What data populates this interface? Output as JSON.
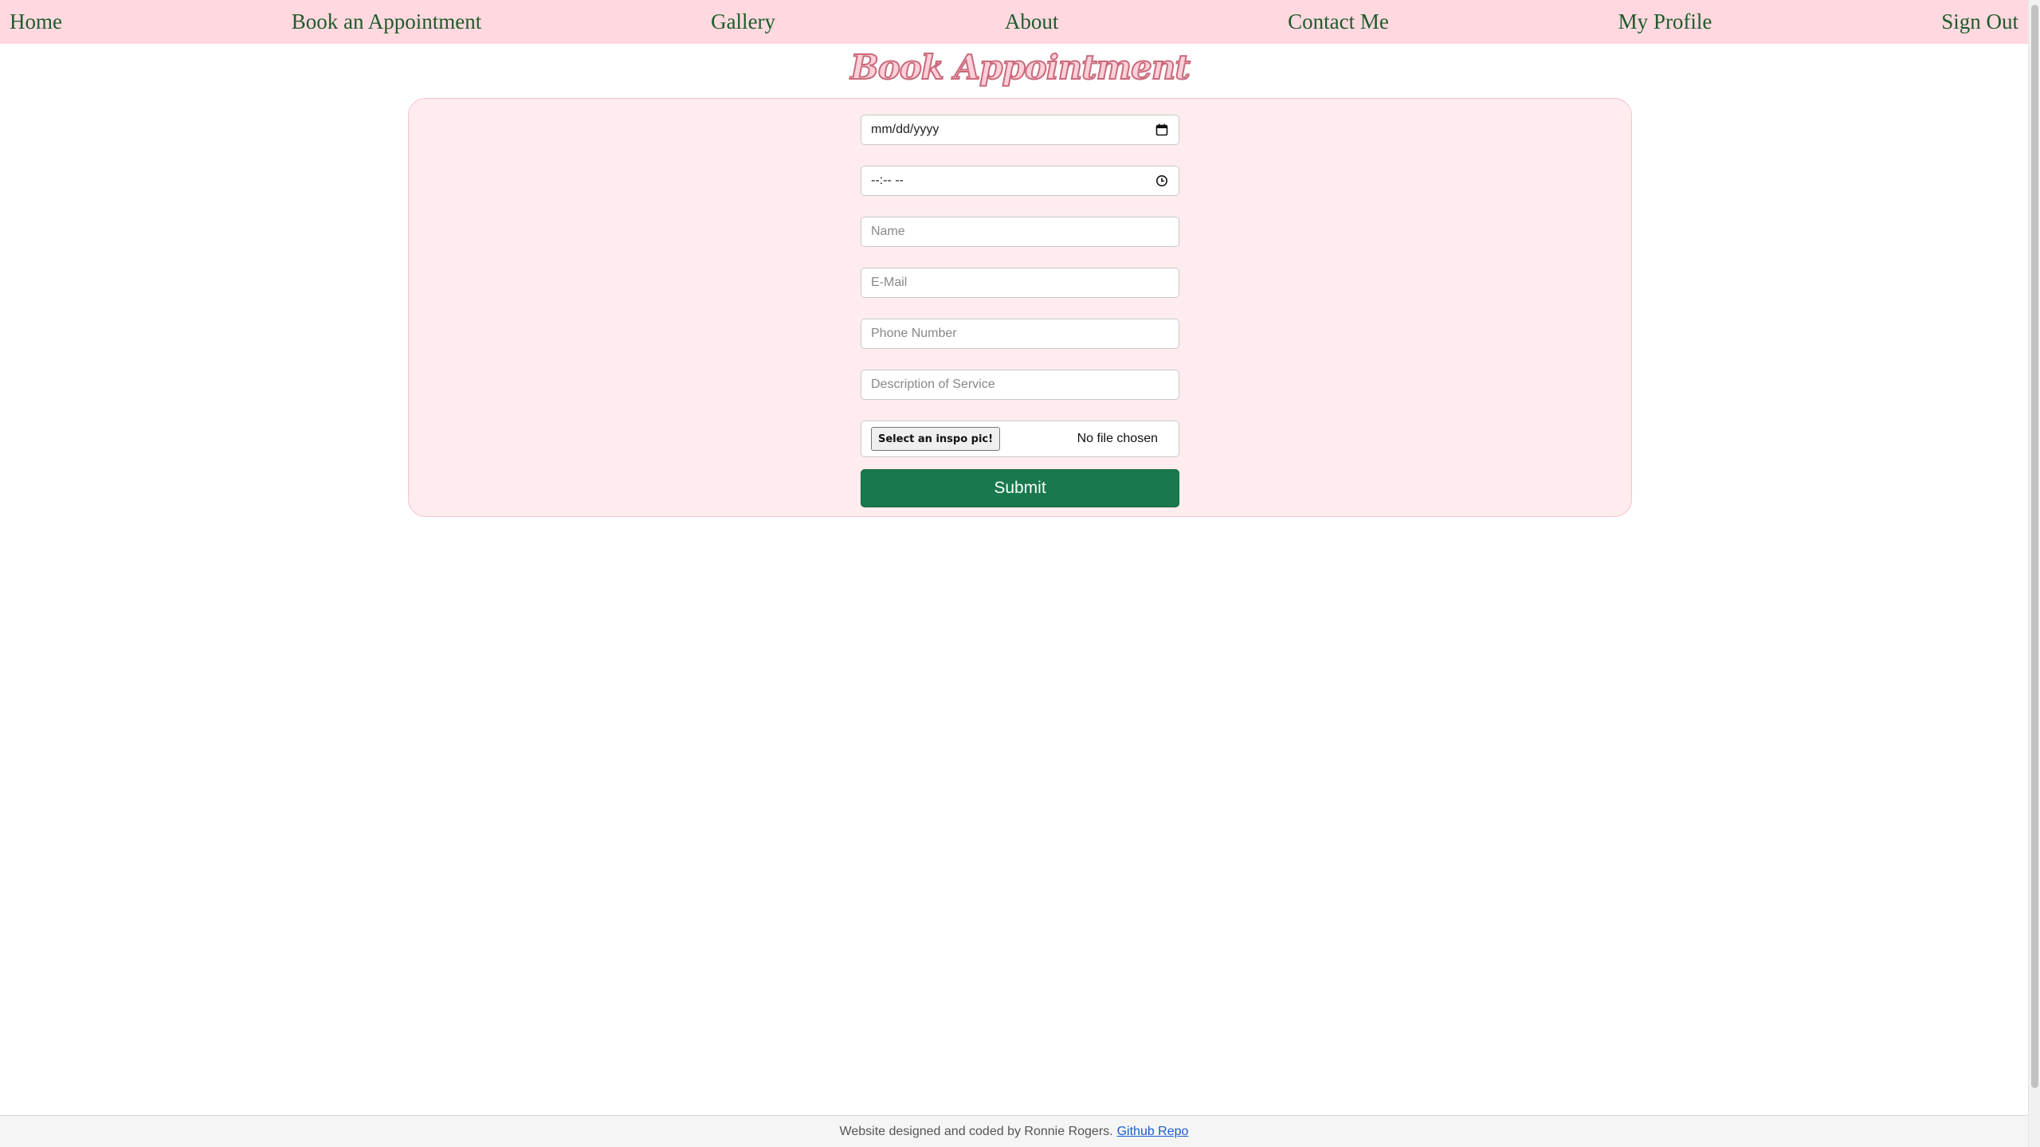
{
  "nav": {
    "items": [
      {
        "label": "Home"
      },
      {
        "label": "Book an Appointment"
      },
      {
        "label": "Gallery"
      },
      {
        "label": "About"
      },
      {
        "label": "Contact Me"
      },
      {
        "label": "My Profile"
      },
      {
        "label": "Sign Out"
      }
    ]
  },
  "page": {
    "title": "Book Appointment"
  },
  "form": {
    "date_value": "mm/dd/yyyy",
    "time_value": "--:-- --",
    "name_placeholder": "Name",
    "email_placeholder": "E-Mail",
    "phone_placeholder": "Phone Number",
    "description_placeholder": "Description of Service",
    "file_button_label": "Select an inspo pic!",
    "file_status": "No file chosen",
    "submit_label": "Submit",
    "date_icon": "calendar-icon",
    "time_icon": "clock-icon"
  },
  "footer": {
    "text": "Website designed and coded by Ronnie Rogers.",
    "link_label": "Github Repo"
  },
  "colors": {
    "nav_background": "#ffd9df",
    "nav_text": "#1f5a2c",
    "card_background": "#ffecee",
    "submit_background": "#19784e",
    "title_fill": "#ffd0d8",
    "title_outline": "#c96a7c"
  }
}
